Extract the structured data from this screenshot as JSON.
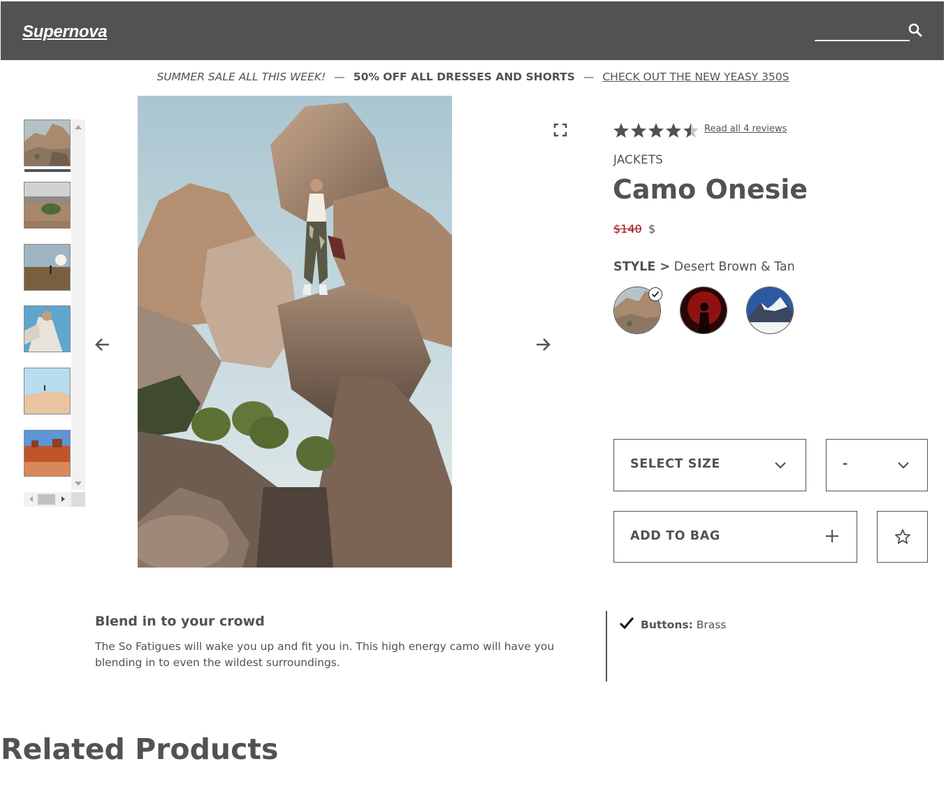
{
  "header": {
    "logo": "Supernova",
    "search": {
      "value": "",
      "placeholder": ""
    },
    "search_icon": "magnifier-icon"
  },
  "announcement": {
    "part1": "SUMMER SALE ALL THIS WEEK!",
    "separator": "—",
    "part2": "50% OFF ALL DRESSES AND SHORTS",
    "part3": "CHECK OUT THE NEW YEASY 350S"
  },
  "gallery": {
    "thumbnails": [
      {
        "name": "boulders-woman",
        "selected": true
      },
      {
        "name": "desert-shrub"
      },
      {
        "name": "desert-sunset"
      },
      {
        "name": "woman-sleeves"
      },
      {
        "name": "sand-dune"
      },
      {
        "name": "canyon-mesas"
      }
    ],
    "prev_icon": "arrow-left-icon",
    "next_icon": "arrow-right-icon",
    "expand_icon": "expand-icon"
  },
  "product": {
    "rating": {
      "stars": 4.5,
      "max": 5
    },
    "reviews_link": "Read all 4 reviews",
    "category": "JACKETS",
    "name": "Camo Onesie",
    "price_original": "$140",
    "price_sale": "$",
    "style_label": "STYLE >",
    "style_value": "Desert Brown & Tan",
    "styles": [
      {
        "name": "desert-brown-tan",
        "selected": true
      },
      {
        "name": "red-silhouette"
      },
      {
        "name": "snowy-mountain"
      }
    ],
    "size_select": "SELECT SIZE",
    "quantity_select": "-",
    "add_to_bag": "ADD TO BAG",
    "favorite_icon": "star-outline-icon"
  },
  "description": {
    "title": "Blend in to your crowd",
    "body": "The So Fatigues will wake you up and fit you in. This high energy camo will have you blending in to even the wildest surroundings.",
    "features": [
      {
        "key": "Buttons:",
        "value": "Brass"
      }
    ]
  },
  "related": {
    "title": "Related Products"
  },
  "colors": {
    "header_bg": "#525252",
    "text": "#525252",
    "strike_price": "#a01010"
  }
}
